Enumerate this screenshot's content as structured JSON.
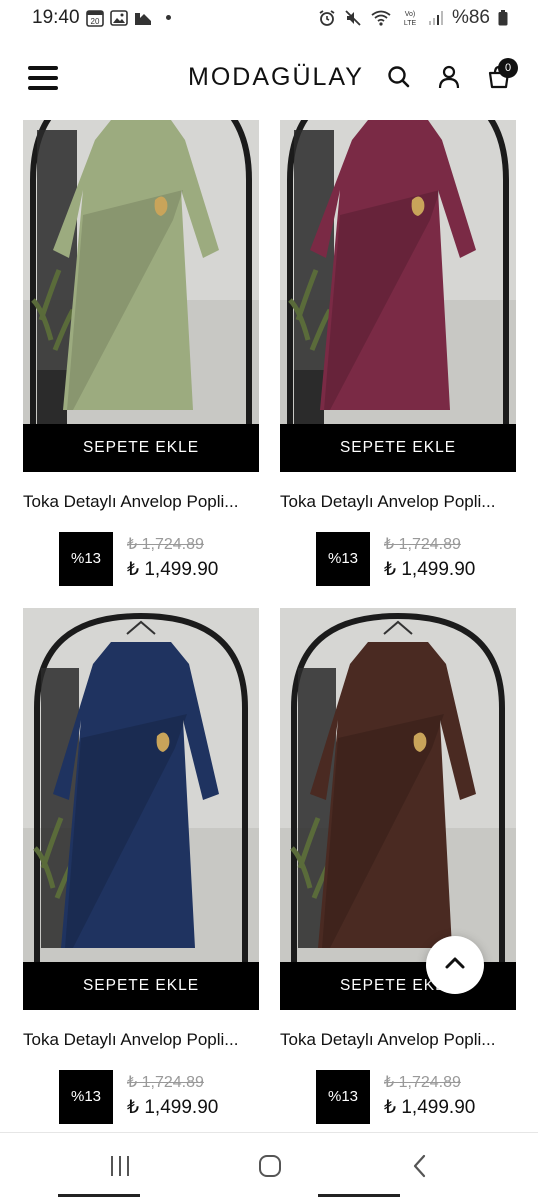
{
  "status_bar": {
    "time": "19:40",
    "battery": "%86",
    "icons": [
      "calendar-icon",
      "gallery-icon",
      "photo-icon",
      "dot-icon",
      "alarm-icon",
      "mute-icon",
      "wifi-icon",
      "volte-icon",
      "signal-icon",
      "battery-icon"
    ]
  },
  "header": {
    "brand": "MODAGÜLAY",
    "cart_count": "0",
    "icons": [
      "menu-icon",
      "search-icon",
      "user-icon",
      "cart-icon"
    ]
  },
  "products": [
    {
      "add_to_cart": "SEPETE EKLE",
      "title": "Toka Detaylı Anvelop Popli...",
      "discount": "%13",
      "old_price": "₺ 1,724.89",
      "new_price": "₺ 1,499.90",
      "dress_color": "#9cab7f"
    },
    {
      "add_to_cart": "SEPETE EKLE",
      "title": "Toka Detaylı Anvelop Popli...",
      "discount": "%13",
      "old_price": "₺ 1,724.89",
      "new_price": "₺ 1,499.90",
      "dress_color": "#7a2a45"
    },
    {
      "add_to_cart": "SEPETE EKLE",
      "title": "Toka Detaylı Anvelop Popli...",
      "discount": "%13",
      "old_price": "₺ 1,724.89",
      "new_price": "₺ 1,499.90",
      "dress_color": "#1f3360"
    },
    {
      "add_to_cart": "SEPETE EKLE",
      "title": "Toka Detaylı Anvelop Popli...",
      "discount": "%13",
      "old_price": "₺ 1,724.89",
      "new_price": "₺ 1,499.90",
      "dress_color": "#4a2a22"
    }
  ],
  "nav": {
    "icons": [
      "recent-apps-icon",
      "home-icon",
      "back-icon"
    ]
  },
  "colors": {
    "button_bg": "#000000",
    "button_text": "#ffffff",
    "old_price": "#999999"
  }
}
